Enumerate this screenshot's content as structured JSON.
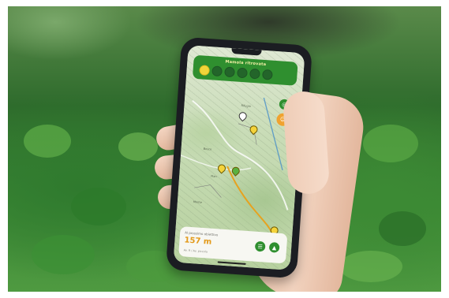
{
  "scene": {
    "description_colors": {
      "accent_green": "#2f8f2f",
      "accent_yellow": "#f0d53a",
      "distance_orange": "#e39a1a"
    }
  },
  "app": {
    "hud": {
      "title": "Mamola ritrovata",
      "badge_count": 6
    },
    "panel": {
      "label": "Al prossimo obiettivo",
      "distance": "157 m",
      "sub": "Av. 9 / Av. piccola"
    },
    "map_labels": [
      "Bosco",
      "Pian",
      "Monte",
      "Rifugio"
    ]
  }
}
